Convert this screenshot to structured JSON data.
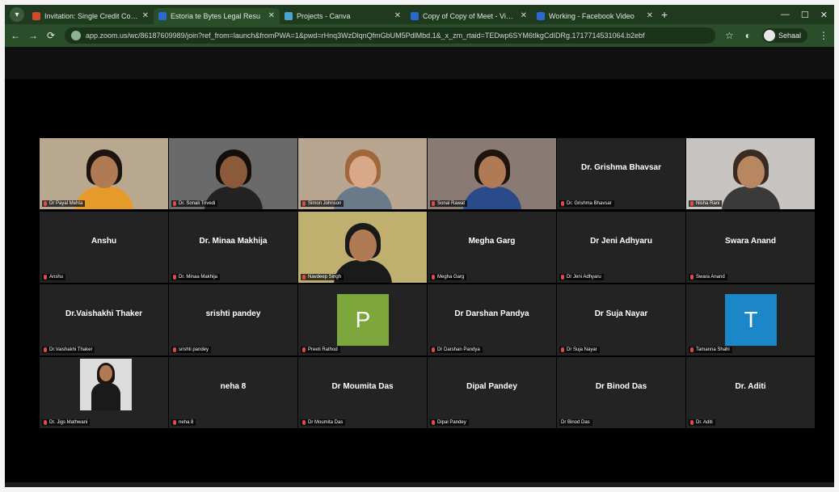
{
  "browser": {
    "tabs": [
      {
        "title": "Invitation: Single Credit Cours",
        "active": false,
        "color": "#d04a2a"
      },
      {
        "title": "Estoria te Bytes Legal Resu",
        "active": true,
        "color": "#2a6ad0"
      },
      {
        "title": "Projects - Canva",
        "active": false,
        "color": "#4aa6d0"
      },
      {
        "title": "Copy of Copy of Meet - Video",
        "active": false,
        "color": "#2a6ad0"
      },
      {
        "title": "Working - Facebook Video",
        "active": false,
        "color": "#2a6ad0"
      }
    ],
    "address": "app.zoom.us/wc/86187609989/join?ref_from=launch&fromPWA=1&pwd=rHnq3WzDlqnQfmGbUM5PdlMbd.1&_x_zm_rtaid=TEDwp6SYM6tlkgCdIDRg.1717714531064.b2ebf",
    "profile_name": "Sehaal"
  },
  "tiles": [
    {
      "display": "",
      "label": "Dr Payal Mehta",
      "kind": "video",
      "bg": "#b8a890",
      "skin": "#b07a55",
      "hair": "#1e140f",
      "shirt": "#e59a2a"
    },
    {
      "display": "",
      "label": "Dr. Sonali Trivedi",
      "kind": "video",
      "bg": "#6a6a6a",
      "skin": "#8a5a3a",
      "hair": "#140e0a",
      "shirt": "#222222"
    },
    {
      "display": "",
      "label": "Simon Johnson",
      "kind": "video",
      "bg": "#b8a690",
      "skin": "#d8a888",
      "hair": "#a0683a",
      "shirt": "#6a7a88",
      "speaking": true
    },
    {
      "display": "",
      "label": "Sonal Rawat",
      "kind": "video",
      "bg": "#8a7a74",
      "skin": "#b07a55",
      "hair": "#1e140f",
      "shirt": "#2a4a8a"
    },
    {
      "display": "Dr. Grishma Bhavsar",
      "label": "Dr. Grishma Bhavsar",
      "kind": "name"
    },
    {
      "display": "",
      "label": "Nisha Rani",
      "kind": "video",
      "bg": "#c8c4c2",
      "skin": "#b88660",
      "hair": "#3a2a22",
      "shirt": "#3a3a3a"
    },
    {
      "display": "Anshu",
      "label": "Anshu",
      "kind": "name"
    },
    {
      "display": "Dr. Minaa Makhija",
      "label": "Dr. Minaa Makhija",
      "kind": "name"
    },
    {
      "display": "",
      "label": "Navdeep Singh",
      "kind": "video",
      "bg": "#c0b070",
      "skin": "#b07a55",
      "hair": "#1a1a1a",
      "shirt": "#1a1a1a"
    },
    {
      "display": "Megha Garg",
      "label": "Megha Garg",
      "kind": "name"
    },
    {
      "display": "Dr Jeni Adhyaru",
      "label": "Dr Jeni Adhyaru",
      "kind": "name"
    },
    {
      "display": "Swara Anand",
      "label": "Swara Anand",
      "kind": "name"
    },
    {
      "display": "Dr.Vaishakhi Thaker",
      "label": "Dr.Vaishakhi Thaker",
      "kind": "name"
    },
    {
      "display": "srishti pandey",
      "label": "srishti pandey",
      "kind": "name"
    },
    {
      "display": "",
      "label": "Preeti Rathod",
      "kind": "avatar",
      "letter": "P",
      "color": "#7da73d"
    },
    {
      "display": "Dr Darshan Pandya",
      "label": "Dr Darshan Pandya",
      "kind": "name"
    },
    {
      "display": "Dr Suja Nayar",
      "label": "Dr Suja Nayar",
      "kind": "name"
    },
    {
      "display": "",
      "label": "Tamanna Shahi",
      "kind": "avatar",
      "letter": "T",
      "color": "#1b86c8"
    },
    {
      "display": "",
      "label": "Dr. Jigs Mathwani",
      "kind": "photo"
    },
    {
      "display": "neha 8",
      "label": "neha 8",
      "kind": "name"
    },
    {
      "display": "Dr Moumita Das",
      "label": "Dr Moumita Das",
      "kind": "name"
    },
    {
      "display": "Dipal Pandey",
      "label": "Dipal Pandey",
      "kind": "name"
    },
    {
      "display": "Dr Binod Das",
      "label": "Dr Binod Das",
      "kind": "name",
      "muted_hidden": true
    },
    {
      "display": "Dr. Aditi",
      "label": "Dr. Aditi",
      "kind": "name"
    }
  ]
}
